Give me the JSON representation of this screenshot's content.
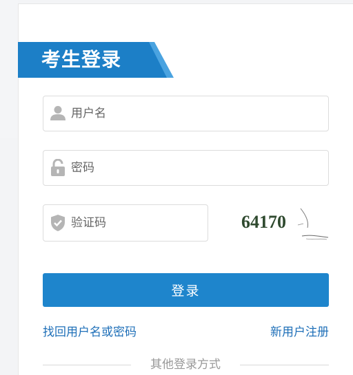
{
  "login": {
    "title": "考生登录",
    "username_placeholder": "用户名",
    "password_placeholder": "密码",
    "captcha_placeholder": "验证码",
    "captcha_code": "64170",
    "login_button": "登录",
    "forgot_link": "找回用户名或密码",
    "register_link": "新用户注册",
    "other_methods": "其他登录方式"
  },
  "icons": {
    "username": "user-icon",
    "password": "lock-icon",
    "captcha": "shield-check-icon"
  },
  "colors": {
    "primary": "#1e85cc",
    "banner_dark": "#1c7fc7",
    "banner_light": "#4aa3e0",
    "link": "#1e6fb8"
  }
}
